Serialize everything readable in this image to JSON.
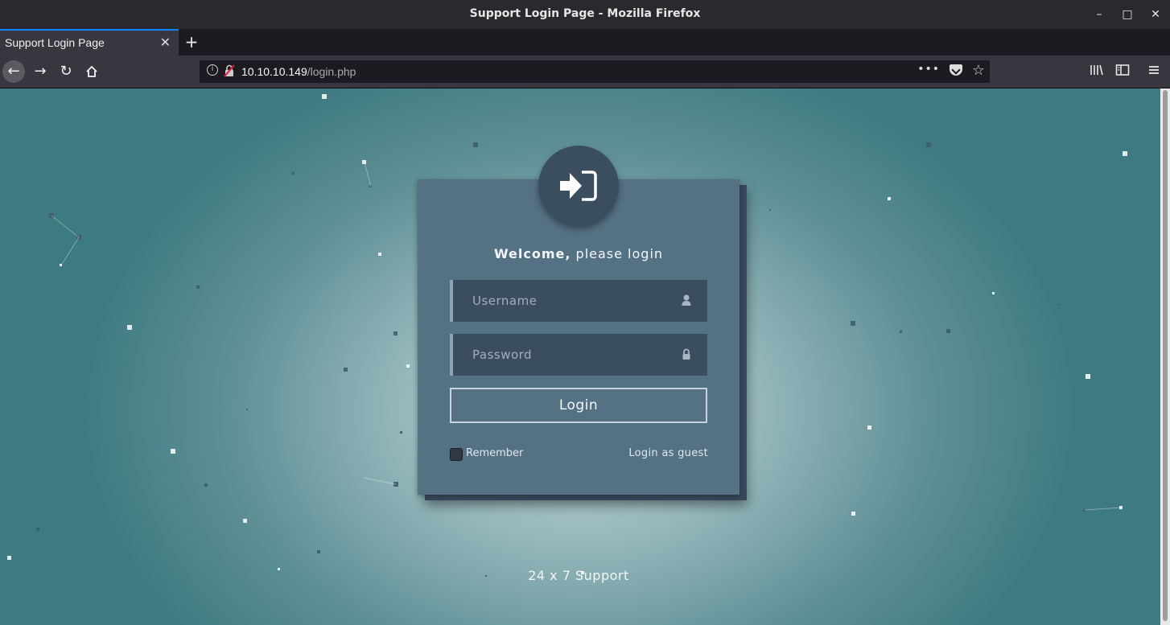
{
  "window": {
    "title": "Support Login Page - Mozilla Firefox",
    "controls": [
      "minimize",
      "maximize",
      "close"
    ]
  },
  "tabs": [
    {
      "label": "Support Login Page",
      "active": true
    }
  ],
  "navbar": {
    "url_host": "10.10.10.149",
    "url_path": "/login.php",
    "icons": [
      "back-icon",
      "forward-icon",
      "reload-icon",
      "home-icon",
      "site-info-icon",
      "insecure-lock-icon",
      "page-actions-icon",
      "pocket-icon",
      "bookmark-star-icon",
      "library-icon",
      "sidebar-icon",
      "menu-icon"
    ]
  },
  "login": {
    "welcome_bold": "Welcome,",
    "welcome_rest": " please login",
    "username_placeholder": "Username",
    "password_placeholder": "Password",
    "login_button": "Login",
    "remember_label": "Remember",
    "guest_link": "Login as guest",
    "footer": "24 x 7 Support"
  },
  "colors": {
    "card": "#557184",
    "field": "#3b4d60",
    "avatar": "#3b4e60",
    "accent_tab": "#0a84ff",
    "background_center": "#c5d6d8",
    "background_edge": "#3e7a82"
  }
}
